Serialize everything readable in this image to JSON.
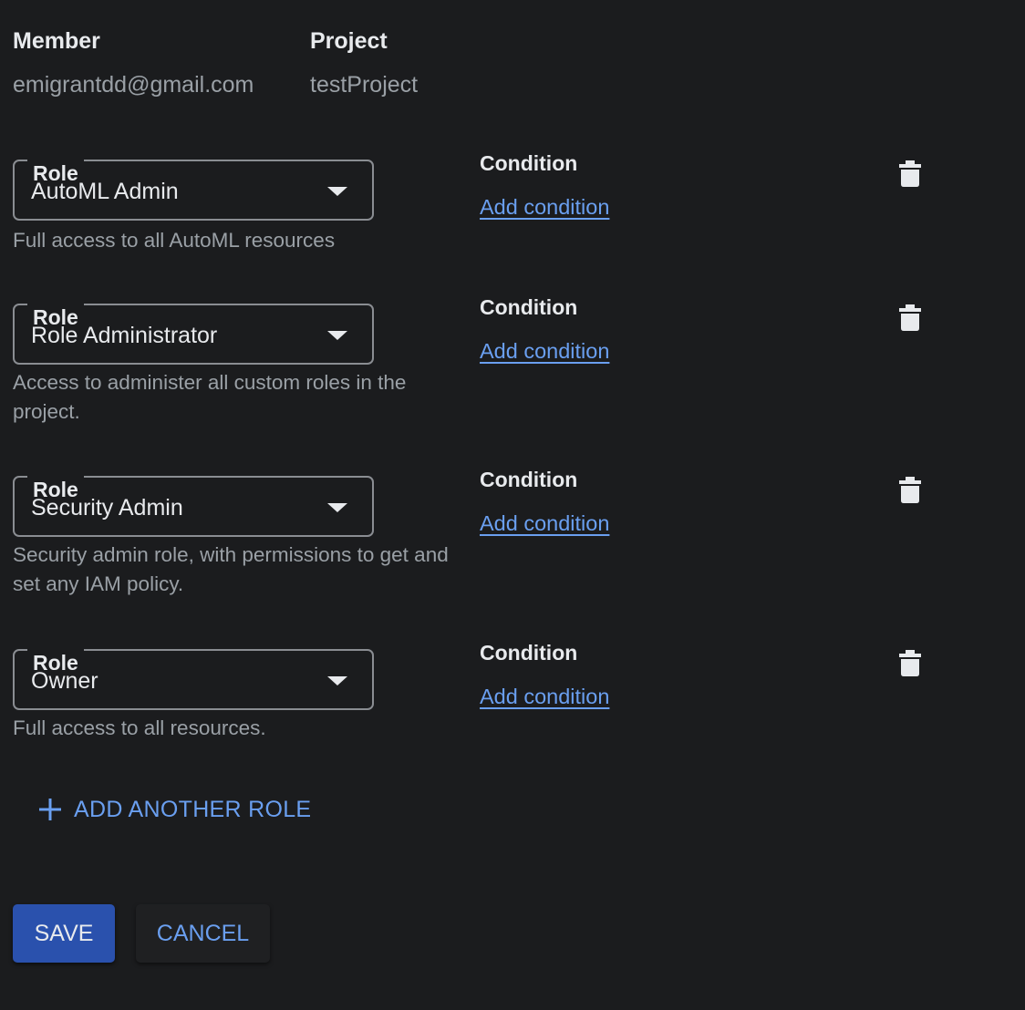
{
  "header": {
    "member_label": "Member",
    "member_value": "emigrantdd@gmail.com",
    "project_label": "Project",
    "project_value": "testProject"
  },
  "roles": [
    {
      "field_label": "Role",
      "value": "AutoML Admin",
      "description": "Full access to all AutoML resources",
      "condition_label": "Condition",
      "condition_link": "Add condition"
    },
    {
      "field_label": "Role",
      "value": "Role Administrator",
      "description": "Access to administer all custom roles in the project.",
      "condition_label": "Condition",
      "condition_link": "Add condition"
    },
    {
      "field_label": "Role",
      "value": "Security Admin",
      "description": "Security admin role, with permissions to get and set any IAM policy.",
      "condition_label": "Condition",
      "condition_link": "Add condition"
    },
    {
      "field_label": "Role",
      "value": "Owner",
      "description": "Full access to all resources.",
      "condition_label": "Condition",
      "condition_link": "Add condition"
    }
  ],
  "add_role": {
    "icon": "plus-icon",
    "label": "ADD ANOTHER ROLE"
  },
  "actions": {
    "save_label": "SAVE",
    "cancel_label": "CANCEL"
  },
  "icons": {
    "delete": "trash-icon",
    "dropdown": "caret-down-icon"
  },
  "colors": {
    "background": "#1b1c1e",
    "accent": "#6a9ff0",
    "primary_button": "#2a51ad",
    "text": "#e8eaed",
    "secondary_text": "#9aa0a6"
  }
}
